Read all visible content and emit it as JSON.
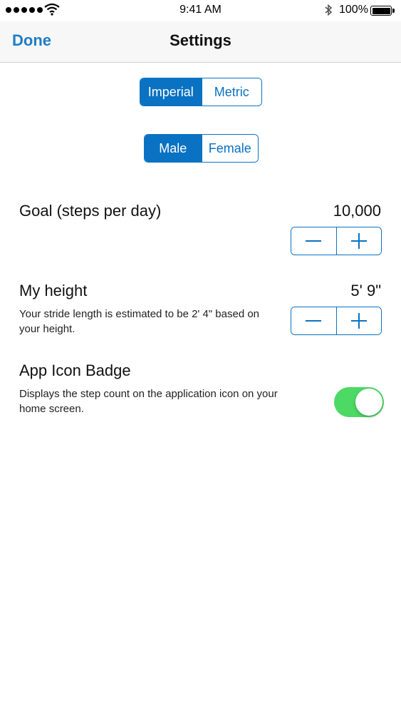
{
  "status_bar": {
    "time": "9:41 AM",
    "battery_percent": "100%",
    "icons": [
      "signal-dots-icon",
      "wifi-icon",
      "bluetooth-icon",
      "battery-icon"
    ]
  },
  "nav": {
    "done_label": "Done",
    "title": "Settings"
  },
  "units": {
    "options": [
      "Imperial",
      "Metric"
    ],
    "selected": "Imperial"
  },
  "gender": {
    "options": [
      "Male",
      "Female"
    ],
    "selected": "Male"
  },
  "goal": {
    "label": "Goal (steps per day)",
    "value": "10,000"
  },
  "height": {
    "label": "My height",
    "value": "5' 9\"",
    "description": "Your stride length is estimated to be 2' 4\" based on your height."
  },
  "badge": {
    "label": "App Icon Badge",
    "description": "Displays the step count on the application icon on your home screen.",
    "enabled": true
  },
  "colors": {
    "accent": "#0a72c2",
    "done": "#1f7cc5",
    "toggle_on": "#4cd964"
  }
}
